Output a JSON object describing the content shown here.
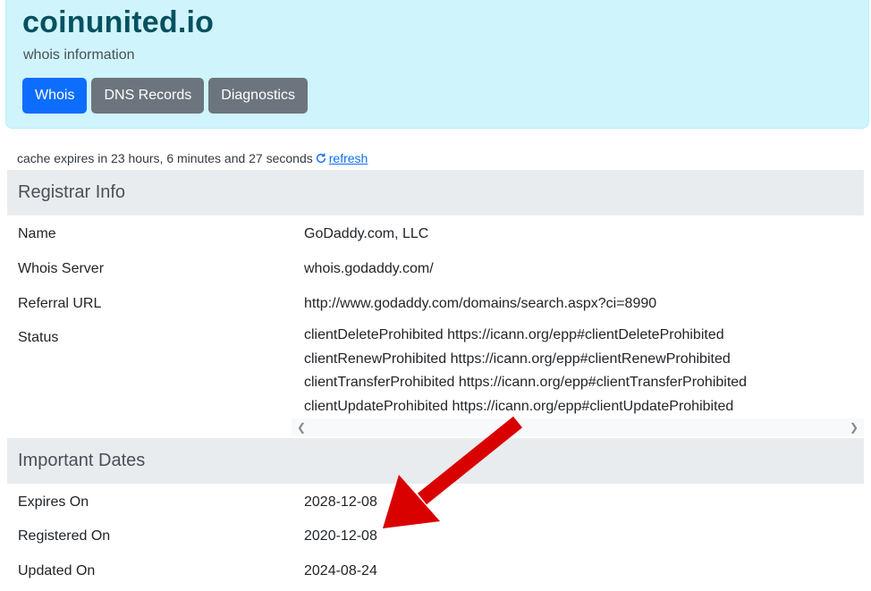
{
  "header": {
    "title": "coinunited.io",
    "subtitle": "whois information",
    "tabs": [
      {
        "label": "Whois",
        "active": true
      },
      {
        "label": "DNS Records",
        "active": false
      },
      {
        "label": "Diagnostics",
        "active": false
      }
    ]
  },
  "cache": {
    "text": "cache expires in 23 hours, 6 minutes and 27 seconds",
    "refresh_label": " refresh"
  },
  "registrar": {
    "heading": "Registrar Info",
    "rows": [
      {
        "key": "Name",
        "value": "GoDaddy.com, LLC"
      },
      {
        "key": "Whois Server",
        "value": "whois.godaddy.com/"
      },
      {
        "key": "Referral URL",
        "value": "http://www.godaddy.com/domains/search.aspx?ci=8990"
      }
    ],
    "status_key": "Status",
    "status_values": [
      "clientDeleteProhibited https://icann.org/epp#clientDeleteProhibited",
      "clientRenewProhibited https://icann.org/epp#clientRenewProhibited",
      "clientTransferProhibited https://icann.org/epp#clientTransferProhibited",
      "clientUpdateProhibited https://icann.org/epp#clientUpdateProhibited"
    ]
  },
  "dates": {
    "heading": "Important Dates",
    "rows": [
      {
        "key": "Expires On",
        "value": "2028-12-08"
      },
      {
        "key": "Registered On",
        "value": "2020-12-08"
      },
      {
        "key": "Updated On",
        "value": "2024-08-24"
      }
    ]
  },
  "colors": {
    "hero_bg": "#cff4fc",
    "title": "#055160",
    "tab_active": "#0d6efd",
    "tab_inactive": "#6c757d",
    "section_bg": "#e9ecef",
    "annotation_arrow": "#d90000"
  },
  "icons": {
    "refresh": "refresh-icon",
    "scroll_left": "chevron-left-icon",
    "scroll_right": "chevron-right-icon"
  }
}
